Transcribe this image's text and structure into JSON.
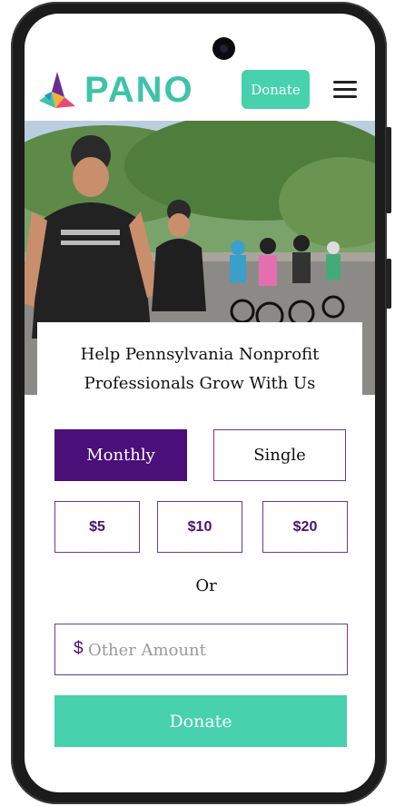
{
  "header": {
    "brand": "PANO",
    "donate_label": "Donate",
    "menu_icon": "hamburger-menu-icon"
  },
  "hero": {
    "image": "group of cyclists riding on a street",
    "tagline": "Help Pennsylvania Nonprofit Professionals Grow With Us"
  },
  "donation": {
    "frequency": {
      "options": [
        "Monthly",
        "Single"
      ],
      "selected": "Monthly"
    },
    "amounts": [
      "$5",
      "$10",
      "$20"
    ],
    "or_label": "Or",
    "other_amount": {
      "currency_symbol": "$",
      "placeholder": "Other Amount",
      "value": ""
    },
    "submit_label": "Donate"
  },
  "colors": {
    "brand_teal": "#3ec3a9",
    "button_teal": "#47d1ad",
    "accent_purple": "#4a0f78",
    "border_purple": "#6a3b93"
  }
}
